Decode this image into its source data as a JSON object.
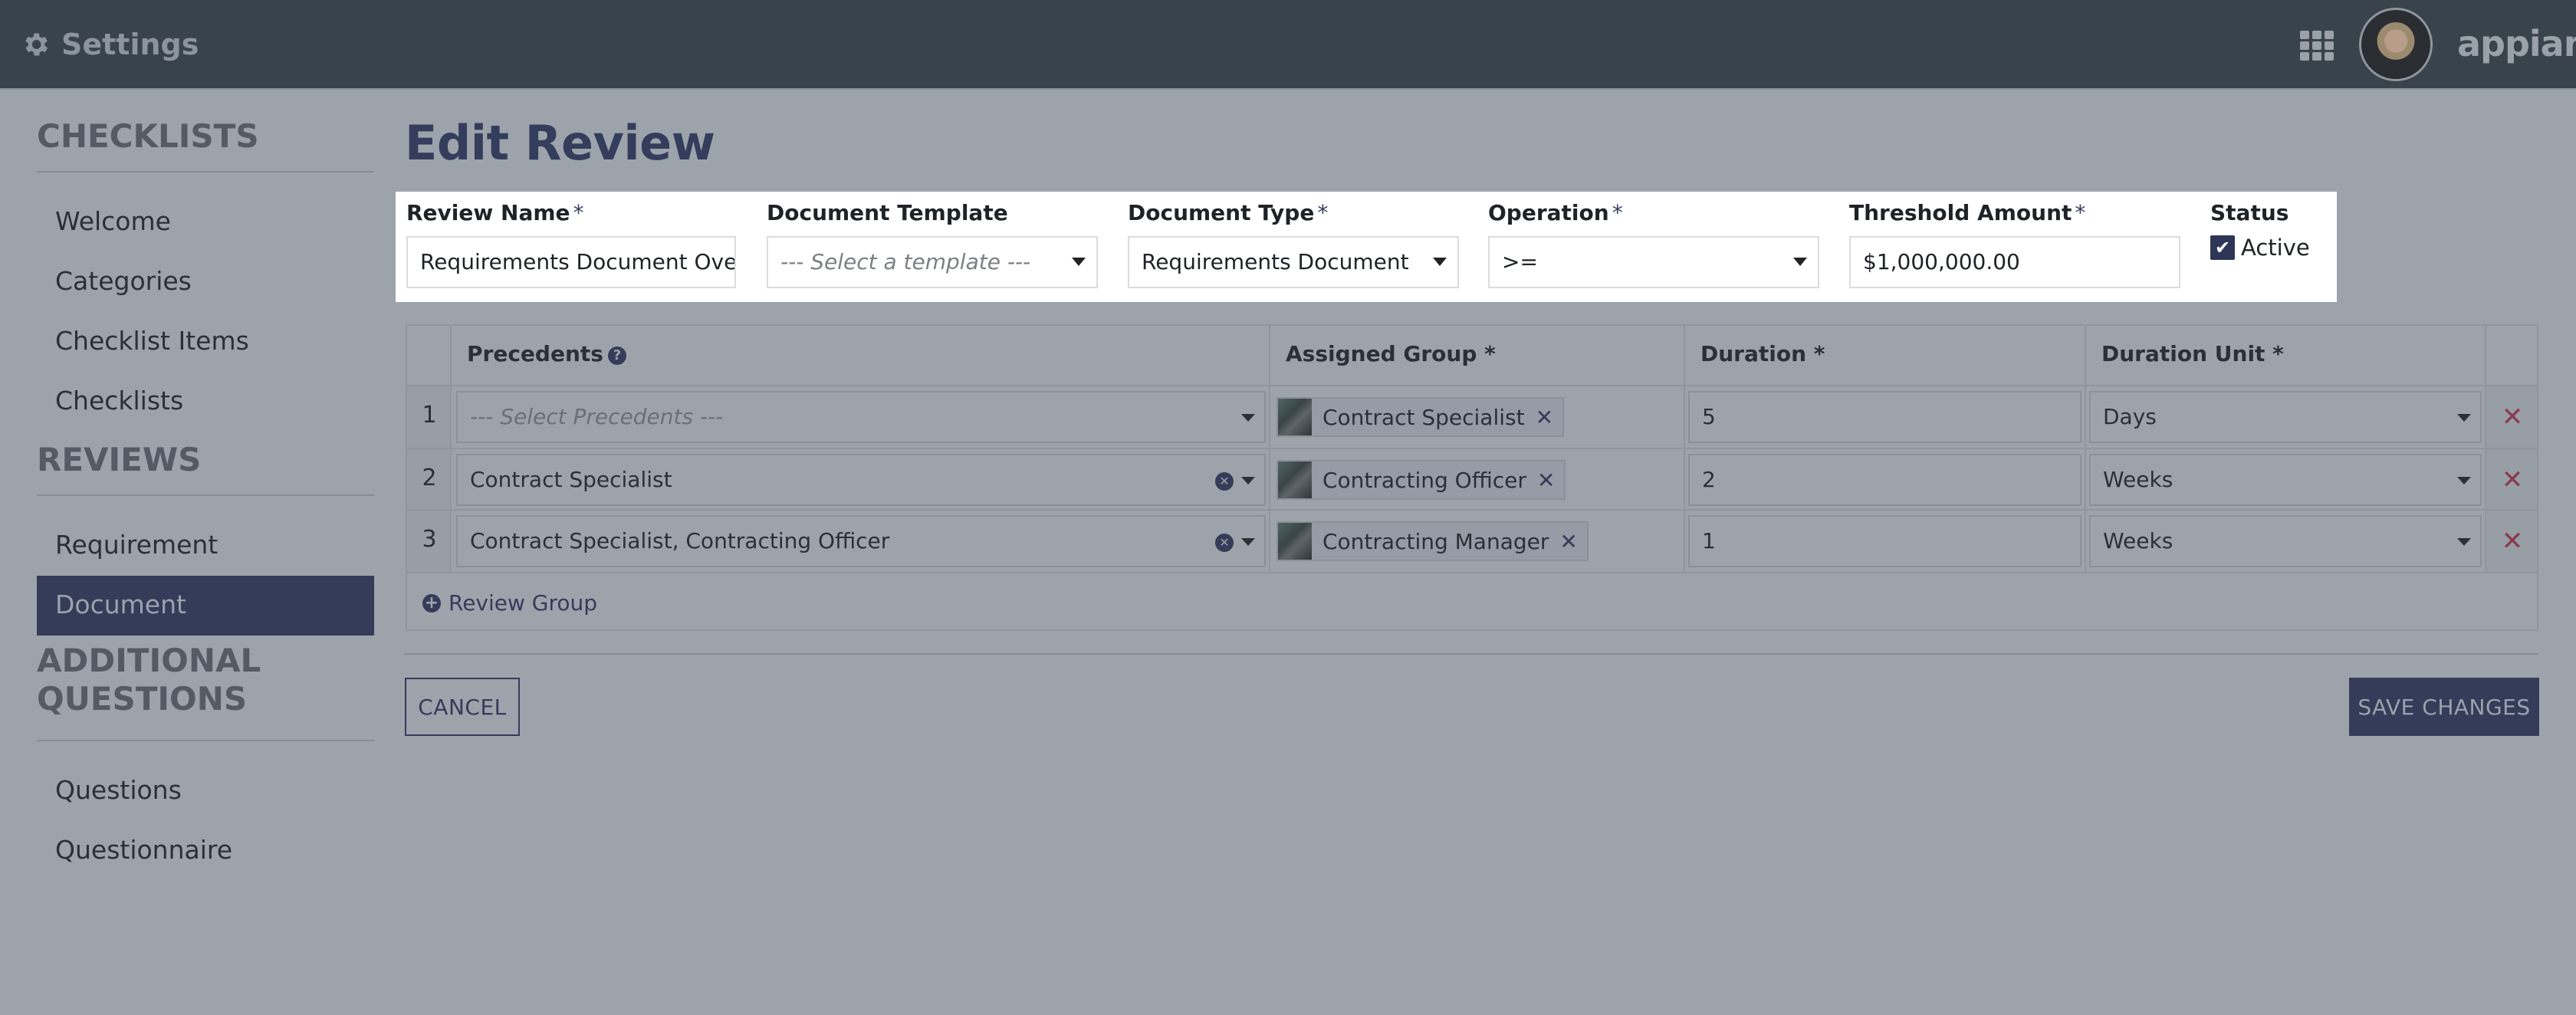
{
  "header": {
    "title": "Settings",
    "title_icon": "gear-icon",
    "apps_icon": "grid-icon",
    "logo_text": "appian"
  },
  "sidebar": {
    "sections": [
      {
        "heading": "CHECKLISTS",
        "items": [
          {
            "label": "Welcome",
            "active": false
          },
          {
            "label": "Categories",
            "active": false
          },
          {
            "label": "Checklist Items",
            "active": false
          },
          {
            "label": "Checklists",
            "active": false
          }
        ]
      },
      {
        "heading": "REVIEWS",
        "items": [
          {
            "label": "Requirement",
            "active": false
          },
          {
            "label": "Document",
            "active": true
          }
        ]
      },
      {
        "heading_line1": "ADDITIONAL",
        "heading_line2": "QUESTIONS",
        "items": [
          {
            "label": "Questions",
            "active": false
          },
          {
            "label": "Questionnaire",
            "active": false
          }
        ]
      }
    ]
  },
  "main": {
    "page_title": "Edit Review",
    "form": {
      "review_name": {
        "label": "Review Name",
        "required_mark": "*",
        "value": "Requirements Document Over"
      },
      "document_template": {
        "label": "Document Template",
        "placeholder": "--- Select a template ---"
      },
      "document_type": {
        "label": "Document Type",
        "required_mark": "*",
        "value": "Requirements Document"
      },
      "operation": {
        "label": "Operation",
        "required_mark": "*",
        "value": ">="
      },
      "threshold_amount": {
        "label": "Threshold Amount",
        "required_mark": "*",
        "value": "$1,000,000.00"
      },
      "status": {
        "label": "Status",
        "checkbox_label": "Active",
        "checked": true
      }
    },
    "grid": {
      "columns": [
        "Precedents",
        "Assigned Group *",
        "Duration *",
        "Duration Unit *"
      ],
      "rows": [
        {
          "num": "1",
          "precedents": "",
          "precedents_placeholder": "--- Select Precedents ---",
          "assigned_group": "Contract Specialist",
          "duration": "5",
          "duration_unit": "Days"
        },
        {
          "num": "2",
          "precedents": "Contract Specialist",
          "assigned_group": "Contracting Officer",
          "duration": "2",
          "duration_unit": "Weeks"
        },
        {
          "num": "3",
          "precedents": "Contract Specialist, Contracting Officer",
          "assigned_group": "Contracting Manager",
          "duration": "1",
          "duration_unit": "Weeks"
        }
      ],
      "add_label": "Review Group"
    },
    "buttons": {
      "cancel": "CANCEL",
      "save": "SAVE CHANGES"
    }
  },
  "colors": {
    "accent": "#343c59",
    "header_bg": "#39434c",
    "page_bg": "#9ca3ab",
    "delete": "#8a3a48"
  }
}
